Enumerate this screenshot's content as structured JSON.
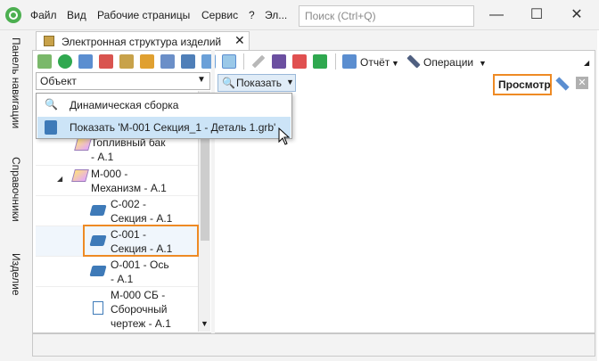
{
  "titlebar": {
    "menu": [
      "Файл",
      "Вид",
      "Рабочие страницы",
      "Сервис",
      "?",
      "Эл..."
    ],
    "search_placeholder": "Поиск (Ctrl+Q)",
    "minimize": "—",
    "maximize": "☐",
    "close": "✕"
  },
  "left_rail": {
    "tabs": [
      "Панель навигации",
      "Справочники",
      "Изделие"
    ]
  },
  "document_tab": {
    "title": "Электронная структура изделий",
    "close": "✕"
  },
  "object_combo": {
    "value": "Объект"
  },
  "tree": {
    "items": [
      {
        "label": "Топливный бак\n- А.1",
        "icon": "assembly-icon",
        "expanded": null
      },
      {
        "label": "М-000 -\nМеханизм - А.1",
        "icon": "assembly-icon",
        "expanded": true
      },
      {
        "label": "С-002 -\nСекция - А.1",
        "icon": "part-icon",
        "expanded": null
      },
      {
        "label": "С-001 -\nСекция - А.1",
        "icon": "part-icon",
        "expanded": null
      },
      {
        "label": "О-001 - Ось\n- А.1",
        "icon": "part-icon",
        "expanded": null
      },
      {
        "label": "М-000 СБ -\nСборочный\nчертеж - А.1",
        "icon": "document-icon",
        "expanded": null
      }
    ]
  },
  "right_toolbar": {
    "report_label": "Отчёт",
    "operations_label": "Операции"
  },
  "show_button": {
    "label": "Показать"
  },
  "preview": {
    "label": "Просмотр"
  },
  "dropdown": {
    "items": [
      {
        "label": "Динамическая сборка",
        "icon": "search-icon"
      },
      {
        "label": "Показать 'М-001 Секция_1 - Деталь 1.grb'",
        "icon": "file-icon"
      }
    ]
  },
  "colors": {
    "highlight": "#ee8a24",
    "selection": "#cce4f7"
  }
}
